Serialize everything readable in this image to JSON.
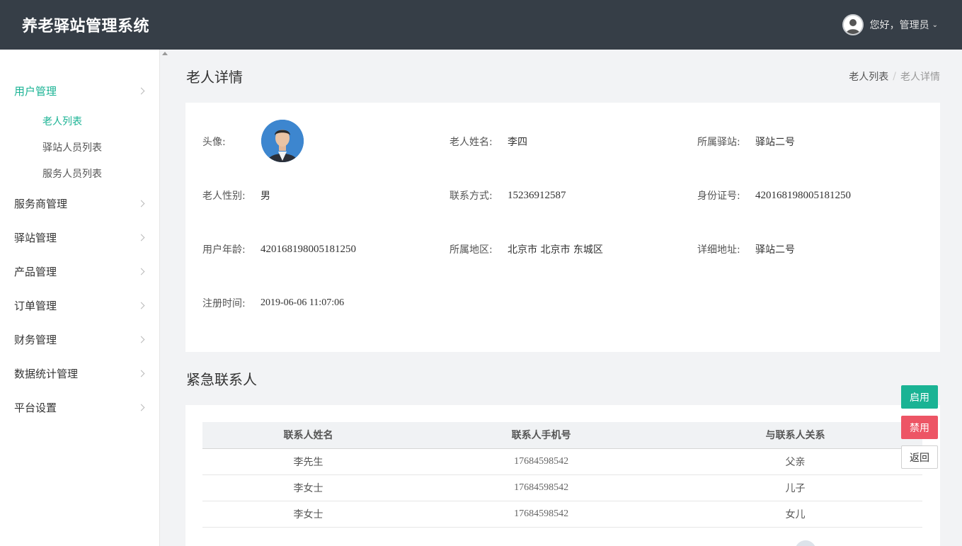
{
  "header": {
    "app_title": "养老驿站管理系统",
    "greeting": "您好，管理员",
    "user_menu_icon": "chevron-down-icon"
  },
  "sidebar": {
    "items": [
      {
        "label": "用户管理",
        "active": true,
        "children": [
          {
            "label": "老人列表",
            "active": true
          },
          {
            "label": "驿站人员列表",
            "active": false
          },
          {
            "label": "服务人员列表",
            "active": false
          }
        ]
      },
      {
        "label": "服务商管理"
      },
      {
        "label": "驿站管理"
      },
      {
        "label": "产品管理"
      },
      {
        "label": "订单管理"
      },
      {
        "label": "财务管理"
      },
      {
        "label": "数据统计管理"
      },
      {
        "label": "平台设置"
      }
    ]
  },
  "page": {
    "title": "老人详情",
    "breadcrumb": [
      "老人列表",
      "老人详情"
    ]
  },
  "detail": {
    "avatar_label": "头像:",
    "name_label": "老人姓名:",
    "name": "李四",
    "station_label": "所属驿站:",
    "station": "驿站二号",
    "gender_label": "老人性别:",
    "gender": "男",
    "phone_label": "联系方式:",
    "phone": "15236912587",
    "id_label": "身份证号:",
    "id_number": "420168198005181250",
    "age_label": "用户年龄:",
    "age": "420168198005181250",
    "region_label": "所属地区:",
    "region": "北京市 北京市 东城区",
    "address_label": "详细地址:",
    "address": "驿站二号",
    "register_label": "注册时间:",
    "register_time": "2019-06-06 11:07:06"
  },
  "contacts": {
    "title": "紧急联系人",
    "columns": [
      "联系人姓名",
      "联系人手机号",
      "与联系人关系"
    ],
    "rows": [
      [
        "李先生",
        "17684598542",
        "父亲"
      ],
      [
        "李女士",
        "17684598542",
        "儿子"
      ],
      [
        "李女士",
        "17684598542",
        "女儿"
      ]
    ]
  },
  "actions": {
    "enable": "启用",
    "disable": "禁用",
    "back": "返回"
  },
  "colors": {
    "topbar": "#363e47",
    "accent": "#1ab394",
    "danger": "#ed5565",
    "page_bg": "#f2f3f5"
  }
}
